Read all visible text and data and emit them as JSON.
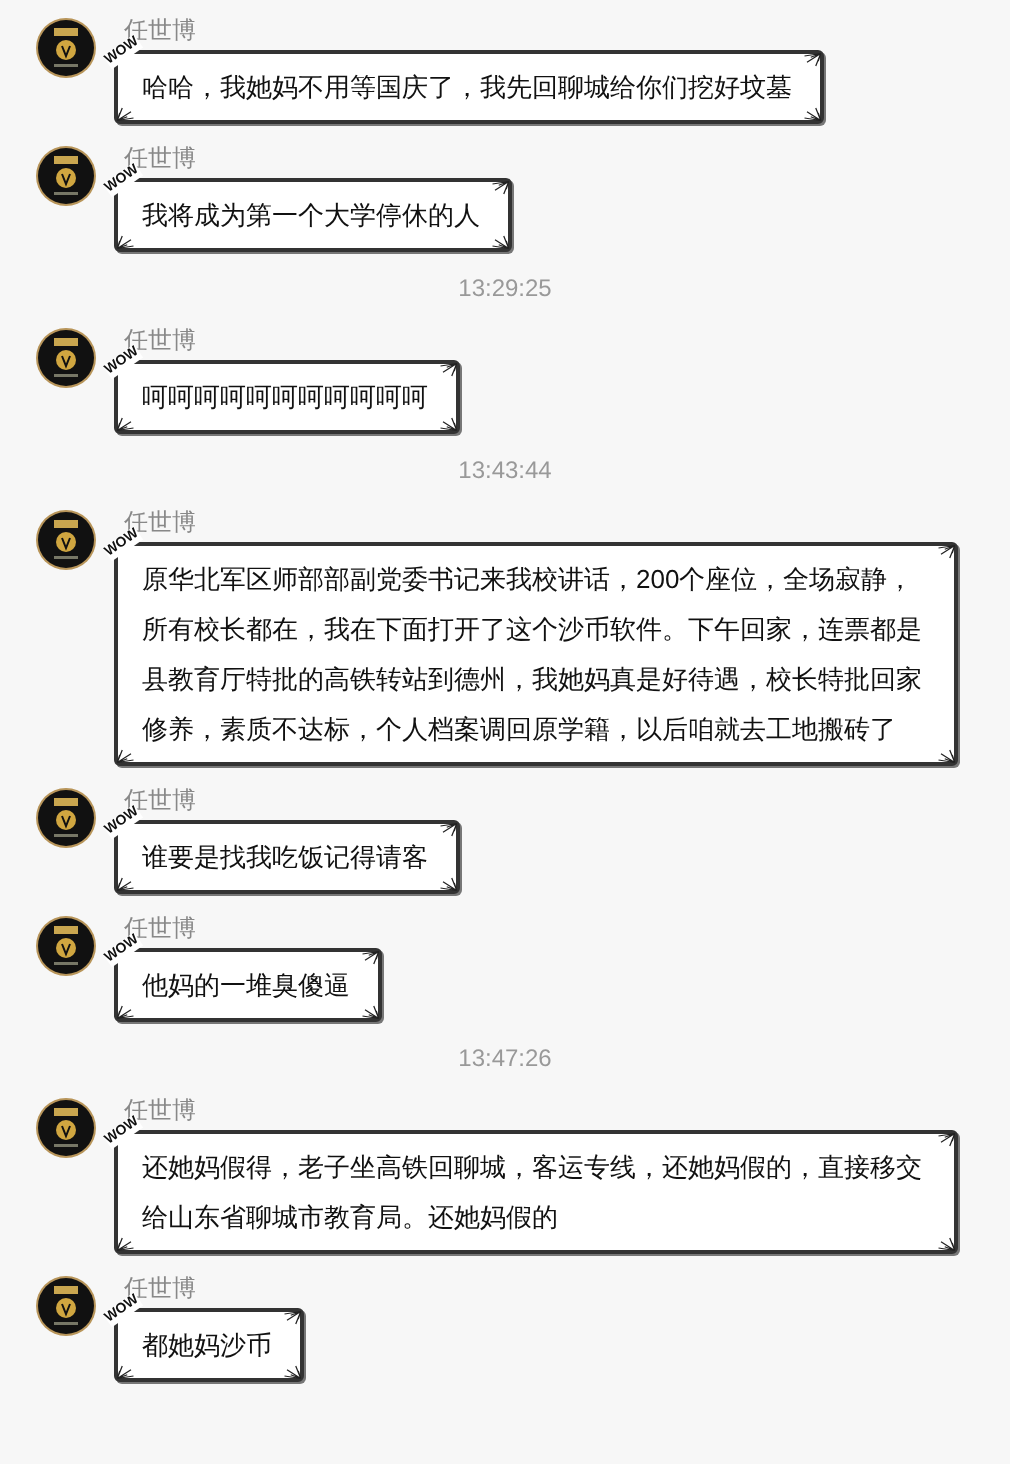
{
  "feed": [
    {
      "kind": "message",
      "sender": "任世博",
      "badge": "WOW",
      "text": "哈哈，我她妈不用等国庆了，我先回聊城给你们挖好坟墓"
    },
    {
      "kind": "message",
      "sender": "任世博",
      "badge": "WOW",
      "text": "我将成为第一个大学停休的人"
    },
    {
      "kind": "time",
      "text": "13:29:25"
    },
    {
      "kind": "message",
      "sender": "任世博",
      "badge": "WOW",
      "text": "呵呵呵呵呵呵呵呵呵呵呵"
    },
    {
      "kind": "time",
      "text": "13:43:44"
    },
    {
      "kind": "message",
      "sender": "任世博",
      "badge": "WOW",
      "text": "原华北军区师部部副党委书记来我校讲话，200个座位，全场寂静，所有校长都在，我在下面打开了这个沙币软件。下午回家，连票都是县教育厅特批的高铁转站到德州，我她妈真是好待遇，校长特批回家修养，素质不达标，个人档案调回原学籍，以后咱就去工地搬砖了"
    },
    {
      "kind": "message",
      "sender": "任世博",
      "badge": "WOW",
      "text": "谁要是找我吃饭记得请客"
    },
    {
      "kind": "message",
      "sender": "任世博",
      "badge": "WOW",
      "text": "他妈的一堆臭傻逼"
    },
    {
      "kind": "time",
      "text": "13:47:26"
    },
    {
      "kind": "message",
      "sender": "任世博",
      "badge": "WOW",
      "text": "还她妈假得，老子坐高铁回聊城，客运专线，还她妈假的，直接移交给山东省聊城市教育局。还她妈假的"
    },
    {
      "kind": "message",
      "sender": "任世博",
      "badge": "WOW",
      "text": "都她妈沙币"
    }
  ]
}
